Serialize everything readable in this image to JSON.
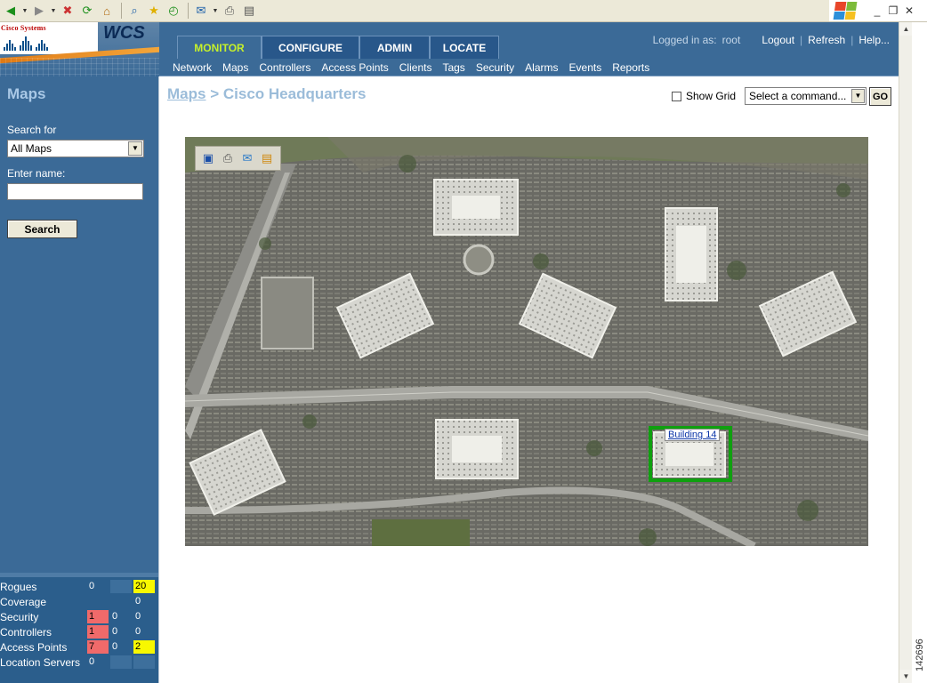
{
  "browser": {
    "toolbar_icons": [
      "back-icon",
      "forward-icon",
      "stop-icon",
      "refresh-icon",
      "home-icon",
      "search-icon",
      "favorites-icon",
      "history-icon",
      "mail-icon",
      "print-icon",
      "edit-icon"
    ],
    "window_controls": [
      "_",
      "❐",
      "✕"
    ]
  },
  "figure_id": "142696",
  "header": {
    "cisco_text": "Cisco Systems",
    "product": "WCS",
    "tabs": [
      {
        "label": "MONITOR",
        "active": true
      },
      {
        "label": "CONFIGURE",
        "active": false
      },
      {
        "label": "ADMIN",
        "active": false
      },
      {
        "label": "LOCATE",
        "active": false
      }
    ],
    "logged_in_label": "Logged in as:",
    "username": "root",
    "links": [
      "Logout",
      "Refresh",
      "Help..."
    ]
  },
  "subnav": [
    "Network",
    "Maps",
    "Controllers",
    "Access Points",
    "Clients",
    "Tags",
    "Security",
    "Alarms",
    "Events",
    "Reports"
  ],
  "sidebar": {
    "title": "Maps",
    "search_for_label": "Search for",
    "search_for_value": "All Maps",
    "enter_name_label": "Enter name:",
    "name_value": "",
    "search_button": "Search"
  },
  "alarm_summary": [
    {
      "label": "Rogues",
      "c1": "0",
      "c2": "",
      "c3": "20",
      "c1_color": "",
      "c2_color": "blank",
      "c3_color": "yellow"
    },
    {
      "label": "Coverage",
      "c1": "",
      "c2": "",
      "c3": "0",
      "c1_color": "",
      "c2_color": "",
      "c3_color": ""
    },
    {
      "label": "Security",
      "c1": "1",
      "c2": "0",
      "c3": "0",
      "c1_color": "red",
      "c2_color": "",
      "c3_color": ""
    },
    {
      "label": "Controllers",
      "c1": "1",
      "c2": "0",
      "c3": "0",
      "c1_color": "red",
      "c2_color": "",
      "c3_color": ""
    },
    {
      "label": "Access Points",
      "c1": "7",
      "c2": "0",
      "c3": "2",
      "c1_color": "red",
      "c2_color": "",
      "c3_color": "yellow"
    },
    {
      "label": "Location Servers",
      "c1": "0",
      "c2": "",
      "c3": "",
      "c1_color": "",
      "c2_color": "blank",
      "c3_color": "blank"
    }
  ],
  "main": {
    "breadcrumb_link": "Maps",
    "breadcrumb_separator": ">",
    "breadcrumb_current": "Cisco Headquarters",
    "show_grid_label": "Show Grid",
    "show_grid_checked": false,
    "command_placeholder": "Select a command...",
    "go_button": "GO",
    "map_tools": [
      "save-icon",
      "print-icon",
      "open-icon",
      "export-icon"
    ],
    "building_label": "Building 14"
  },
  "colors": {
    "header_blue": "#3b6a97",
    "active_tab_text": "#c6f02a",
    "alarm_red": "#f06a6a",
    "alarm_yellow": "#f8f800",
    "building_highlight": "#0fa00f"
  }
}
